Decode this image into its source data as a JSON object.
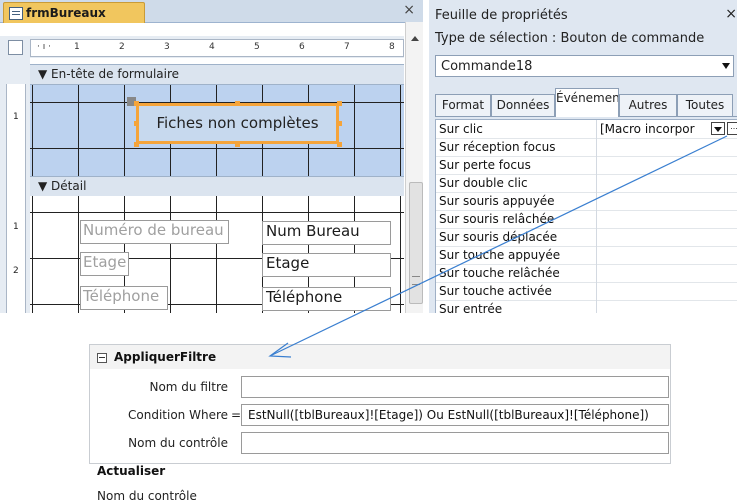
{
  "designer": {
    "tab_title": "frmBureaux",
    "close_glyph": "×",
    "ruler_marks": [
      "1",
      "2",
      "3",
      "4",
      "5",
      "6",
      "7",
      "8"
    ],
    "vruler_marks": [
      "1",
      "1",
      "2"
    ],
    "section_header": "En-tête de formulaire",
    "section_detail": "Détail",
    "button_caption": "Fiches non complètes",
    "labels": [
      "Numéro de bureau",
      "Etage",
      "Téléphone"
    ],
    "textboxes": [
      "Num Bureau",
      "Etage",
      "Téléphone"
    ]
  },
  "property_sheet": {
    "title": "Feuille de propriétés",
    "close_glyph": "×",
    "selection_type": "Type de sélection :  Bouton de commande",
    "object_name": "Commande18",
    "tabs": [
      "Format",
      "Données",
      "Événement",
      "Autres",
      "Toutes"
    ],
    "active_tab": "Événement",
    "rows": [
      {
        "name": "Sur clic",
        "value": "[Macro incorpor"
      },
      {
        "name": "Sur réception focus",
        "value": ""
      },
      {
        "name": "Sur perte focus",
        "value": ""
      },
      {
        "name": "Sur double clic",
        "value": ""
      },
      {
        "name": "Sur souris appuyée",
        "value": ""
      },
      {
        "name": "Sur souris relâchée",
        "value": ""
      },
      {
        "name": "Sur souris déplacée",
        "value": ""
      },
      {
        "name": "Sur touche appuyée",
        "value": ""
      },
      {
        "name": "Sur touche relâchée",
        "value": ""
      },
      {
        "name": "Sur touche activée",
        "value": ""
      },
      {
        "name": "Sur entrée",
        "value": ""
      }
    ],
    "build_button_glyph": "..."
  },
  "macro": {
    "action": "AppliquerFiltre",
    "fields": [
      {
        "label": "Nom du filtre",
        "value": ""
      },
      {
        "label": "Condition Where",
        "value": "EstNull([tblBureaux]![Etage]) Ou EstNull([tblBureaux]![Téléphone])"
      },
      {
        "label": "Nom du contrôle",
        "value": ""
      }
    ],
    "equals": "=",
    "action2": "Actualiser",
    "action2_field": "Nom du contrôle"
  },
  "colors": {
    "selection_orange": "#f5a43a",
    "header_section": "#bcd2ef",
    "annotation_arrow": "#3a7fd0"
  }
}
